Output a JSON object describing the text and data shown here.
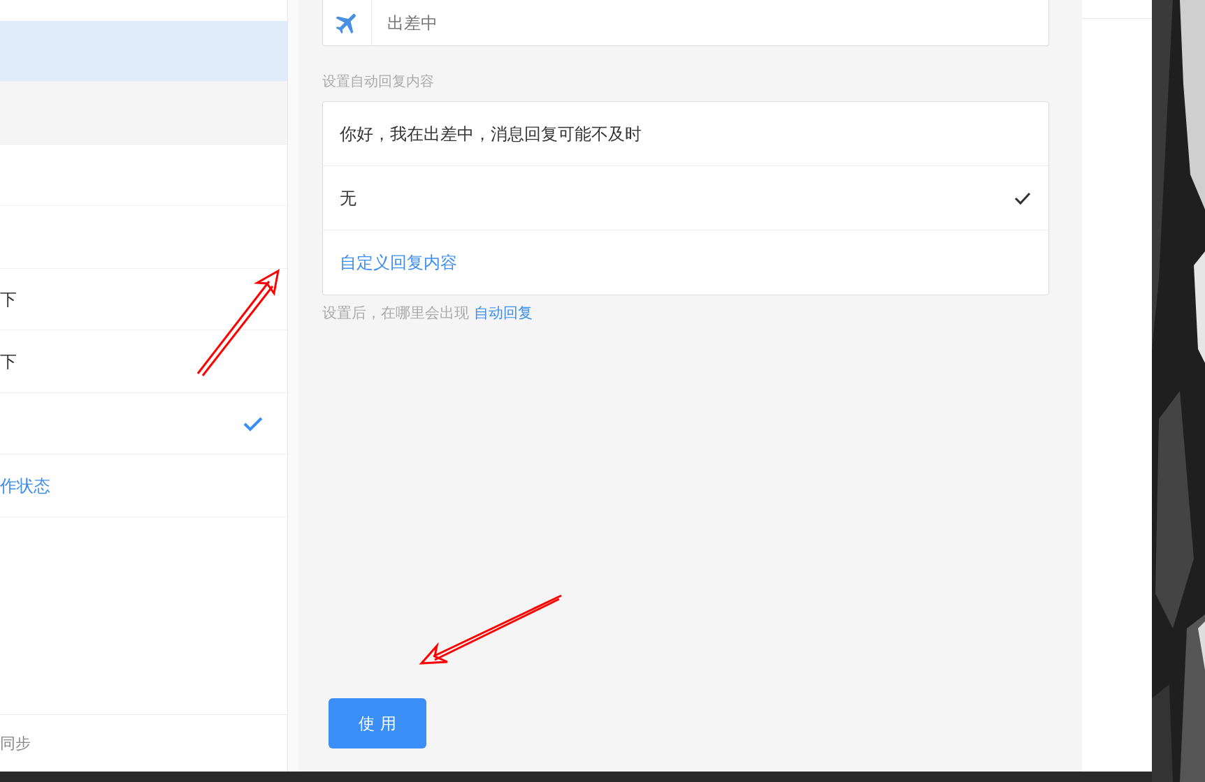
{
  "left_list": {
    "rows": [
      {
        "kind": "blank",
        "selected": true,
        "checked": false
      },
      {
        "kind": "header",
        "selected": false,
        "checked": false
      },
      {
        "kind": "blank",
        "selected": false,
        "checked": false
      },
      {
        "kind": "blank",
        "selected": false,
        "checked": false
      },
      {
        "kind": "text",
        "text": "下",
        "selected": false,
        "checked": false
      },
      {
        "kind": "text",
        "text": "下",
        "selected": false,
        "checked": false
      },
      {
        "kind": "blank",
        "selected": false,
        "checked": true
      },
      {
        "kind": "link",
        "text": "作状态",
        "selected": false,
        "checked": false
      }
    ],
    "footer": "同步"
  },
  "status_field": {
    "value": "出差中"
  },
  "reply_label": "设置自动回复内容",
  "reply_options": [
    {
      "text": "你好，我在出差中，消息回复可能不及时",
      "selected": false
    },
    {
      "text": "无",
      "selected": true
    }
  ],
  "custom_reply_link": "自定义回复内容",
  "hint": {
    "text": "设置后，在哪里会出现",
    "link": "自动回复"
  },
  "use_button": "使 用"
}
